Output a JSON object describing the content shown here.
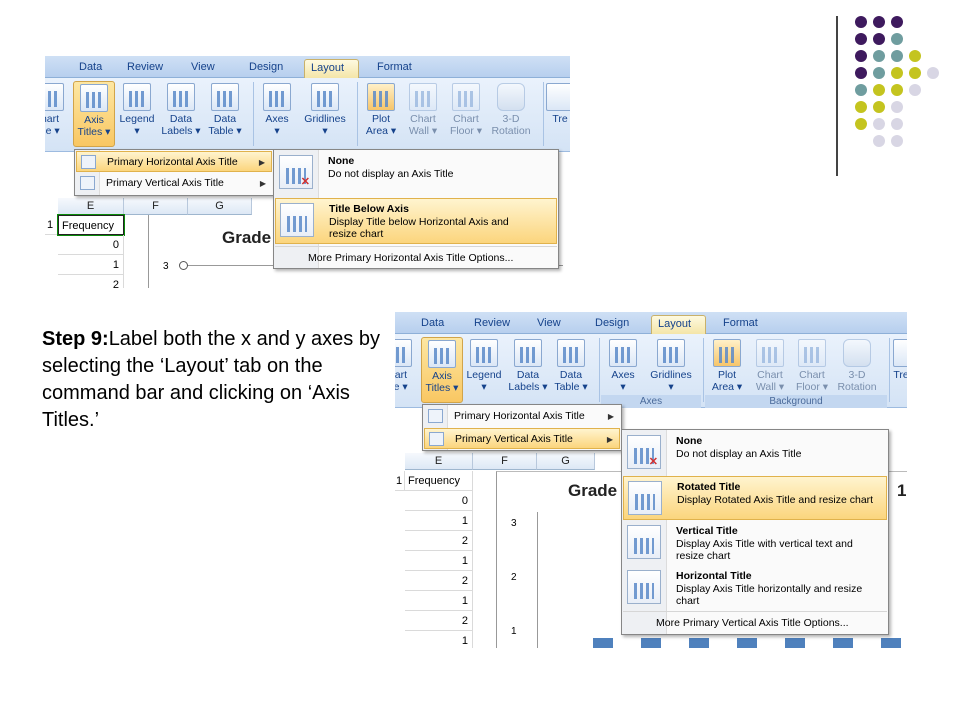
{
  "slide": {
    "step_label": "Step 9:",
    "step_text": "Label both the x and y axes by selecting the ‘Layout’ tab on the command bar and clicking on ‘Axis Titles.’",
    "accent_colors": [
      "#3e1a5e",
      "#6f9d9f",
      "#c4c41f",
      "#d8d6e4"
    ]
  },
  "screenshot1": {
    "tabs": [
      "Data",
      "Review",
      "View",
      "Design",
      "Layout",
      "Format"
    ],
    "active_tab": "Layout",
    "ribbon_buttons": [
      {
        "label_line1": "hart",
        "label_line2": "tle ▾",
        "icon": "chart-title-icon"
      },
      {
        "label_line1": "Axis",
        "label_line2": "Titles ▾",
        "icon": "axis-titles-icon"
      },
      {
        "label_line1": "Legend",
        "label_line2": "▾",
        "icon": "legend-icon"
      },
      {
        "label_line1": "Data",
        "label_line2": "Labels ▾",
        "icon": "data-labels-icon"
      },
      {
        "label_line1": "Data",
        "label_line2": "Table ▾",
        "icon": "data-table-icon"
      },
      {
        "label_line1": "Axes",
        "label_line2": "▾",
        "icon": "axes-icon"
      },
      {
        "label_line1": "Gridlines",
        "label_line2": "▾",
        "icon": "gridlines-icon"
      },
      {
        "label_line1": "Plot",
        "label_line2": "Area ▾",
        "icon": "plot-area-icon"
      },
      {
        "label_line1": "Chart",
        "label_line2": "Wall ▾",
        "icon": "chart-wall-icon"
      },
      {
        "label_line1": "Chart",
        "label_line2": "Floor ▾",
        "icon": "chart-floor-icon"
      },
      {
        "label_line1": "3-D",
        "label_line2": "Rotation",
        "icon": "3d-rotation-icon"
      },
      {
        "label_line1": "Tre",
        "label_line2": "",
        "icon": "trendline-icon"
      }
    ],
    "menu": {
      "items": [
        "Primary Horizontal Axis Title",
        "Primary Vertical Axis Title"
      ]
    },
    "submenu": {
      "options": [
        {
          "title": "None",
          "desc": "Do not display an Axis Title"
        },
        {
          "title": "Title Below Axis",
          "desc": "Display Title below Horizontal Axis and resize chart"
        }
      ],
      "more": "More Primary Horizontal Axis Title Options..."
    },
    "columns": [
      "E",
      "F",
      "G"
    ],
    "column_header": "Frequency",
    "row_prefix": "1",
    "values": [
      "0",
      "1",
      "2"
    ],
    "chart_title": "Grade",
    "axis_value": "3"
  },
  "screenshot2": {
    "tabs": [
      "Data",
      "Review",
      "View",
      "Design",
      "Layout",
      "Format"
    ],
    "active_tab": "Layout",
    "group_labels": [
      "Axes",
      "Background"
    ],
    "menu": {
      "items": [
        "Primary Horizontal Axis Title",
        "Primary Vertical Axis Title"
      ]
    },
    "submenu": {
      "options": [
        {
          "title": "None",
          "desc": "Do not display an Axis Title"
        },
        {
          "title": "Rotated Title",
          "desc": "Display Rotated Axis Title and resize chart"
        },
        {
          "title": "Vertical Title",
          "desc": "Display Axis Title with vertical text and resize chart"
        },
        {
          "title": "Horizontal Title",
          "desc": "Display Axis Title horizontally and resize chart"
        }
      ],
      "more": "More Primary Vertical Axis Title Options..."
    },
    "columns": [
      "E",
      "F",
      "G"
    ],
    "column_header": "Frequency",
    "row_prefix": "1",
    "values": [
      "0",
      "1",
      "2",
      "1",
      "2",
      "1",
      "2",
      "1"
    ],
    "chart_title": "Grade",
    "chart_title_suffix": "1",
    "axis_values": [
      "3",
      "2",
      "1"
    ]
  }
}
